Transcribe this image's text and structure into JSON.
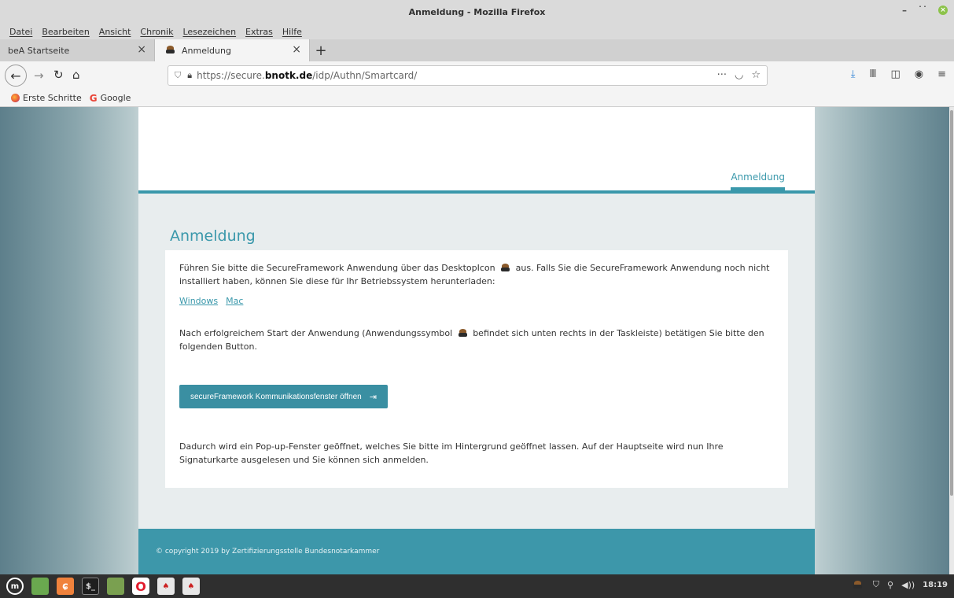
{
  "window": {
    "title": "Anmeldung - Mozilla Firefox"
  },
  "menubar": {
    "items": [
      "Datei",
      "Bearbeiten",
      "Ansicht",
      "Chronik",
      "Lesezeichen",
      "Extras",
      "Hilfe"
    ]
  },
  "tabs": [
    {
      "label": "beA Startseite",
      "active": false
    },
    {
      "label": "Anmeldung",
      "active": true
    }
  ],
  "addressbar": {
    "url_prefix": "https://secure.",
    "url_host": "bnotk.de",
    "url_path": "/idp/Authn/Smartcard/"
  },
  "bookmarks": [
    {
      "label": "Erste Schritte",
      "icon": "firefox-icon"
    },
    {
      "label": "Google",
      "icon": "google-icon"
    }
  ],
  "page": {
    "nav_item": "Anmeldung",
    "title": "Anmeldung",
    "intro_before_icon": "Führen Sie bitte die SecureFramework Anwendung über das DesktopIcon",
    "intro_after_icon": "aus. Falls Sie die SecureFramework Anwendung noch nicht installiert haben, können Sie diese für Ihr Betriebssystem herunterladen:",
    "download_links": [
      "Windows",
      "Mac"
    ],
    "start_before_icon": "Nach erfolgreichem Start der Anwendung (Anwendungssymbol",
    "start_after_icon": "befindet sich unten rechts in der Taskleiste) betätigen Sie bitte den folgenden Button.",
    "button_label": "secureFramework Kommunikationsfenster öffnen",
    "popup_text": "Dadurch wird ein Pop-up-Fenster geöffnet, welches Sie bitte im Hintergrund geöffnet lassen. Auf der Hauptseite wird nun Ihre Signaturkarte ausgelesen und Sie können sich anmelden.",
    "footer": "© copyright 2019 by Zertifizierungsstelle Bundesnotarkammer"
  },
  "taskbar": {
    "clock": "18:19"
  },
  "colors": {
    "accent": "#3a98ab",
    "footer": "#3d97aa",
    "button": "#3a8fa2"
  }
}
